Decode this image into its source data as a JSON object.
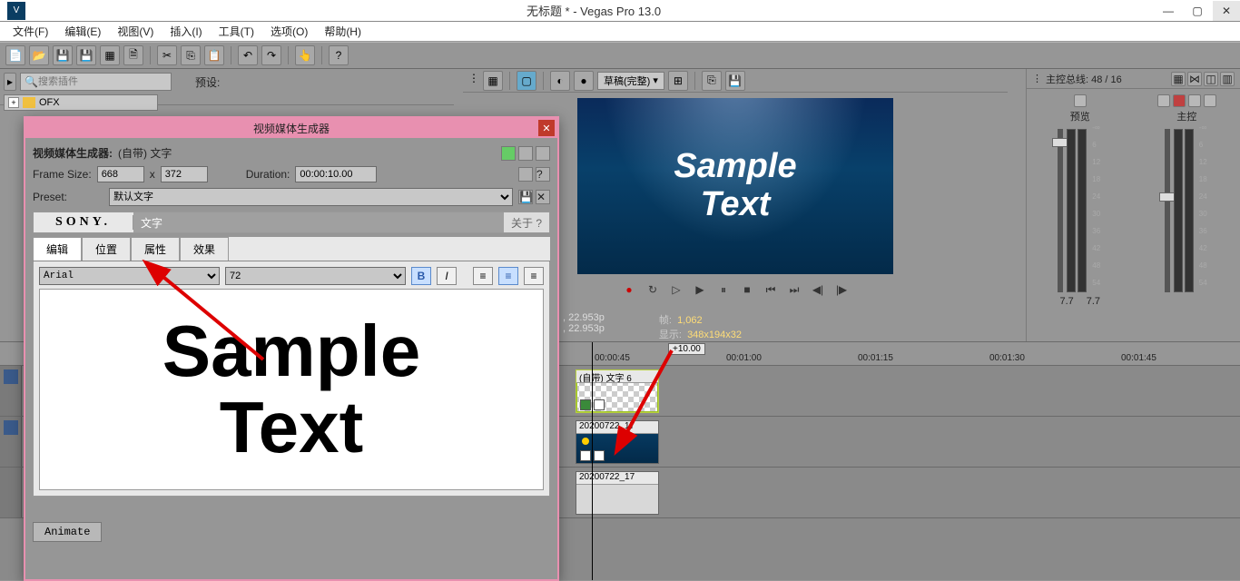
{
  "window": {
    "title": "无标题 * - Vegas Pro 13.0"
  },
  "menu": [
    "文件(F)",
    "编辑(E)",
    "视图(V)",
    "插入(I)",
    "工具(T)",
    "选项(O)",
    "帮助(H)"
  ],
  "plugin": {
    "search_placeholder": "搜索插件",
    "preset_label": "预设:",
    "ofx": "OFX"
  },
  "preview": {
    "quality": "草稿(完整)",
    "sample_line1": "Sample",
    "sample_line2": "Text",
    "info_fps1": ", 22.953p",
    "info_fps2": ", 22.953p",
    "frames_label": "帧:",
    "frames_value": "1,062",
    "display_label": "显示:",
    "display_value": "348x194x32"
  },
  "master": {
    "header": "主控总线: 48 / 16",
    "col1": "预览",
    "col2": "主控",
    "readout1": "7.7",
    "readout2": "7.7",
    "ticks": [
      "-∞",
      "6",
      "12",
      "18",
      "24",
      "30",
      "36",
      "42",
      "48",
      "54"
    ]
  },
  "timeline": {
    "zoom": "+10.00",
    "marks": [
      "00:00:45",
      "00:01:00",
      "00:01:15",
      "00:01:30",
      "00:01:45"
    ],
    "clip1": "(自带) 文字 6",
    "clip2": "20200722_17",
    "clip3": "20200722_17"
  },
  "dialog": {
    "title": "视频媒体生成器",
    "gen_label": "视频媒体生成器:",
    "gen_value": "(自带) 文字",
    "framesize_label": "Frame Size:",
    "width": "668",
    "x": "x",
    "height": "372",
    "duration_label": "Duration:",
    "duration": "00:00:10.00",
    "preset_label": "Preset:",
    "preset_value": "默认文字",
    "sony": "SONY.",
    "sony_txt": "文字",
    "about": "关于  ?",
    "tabs": [
      "编辑",
      "位置",
      "属性",
      "效果"
    ],
    "font": "Arial",
    "size": "72",
    "bold": "B",
    "italic": "I",
    "sample_line1": "Sample",
    "sample_line2": "Text",
    "animate": "Animate"
  }
}
